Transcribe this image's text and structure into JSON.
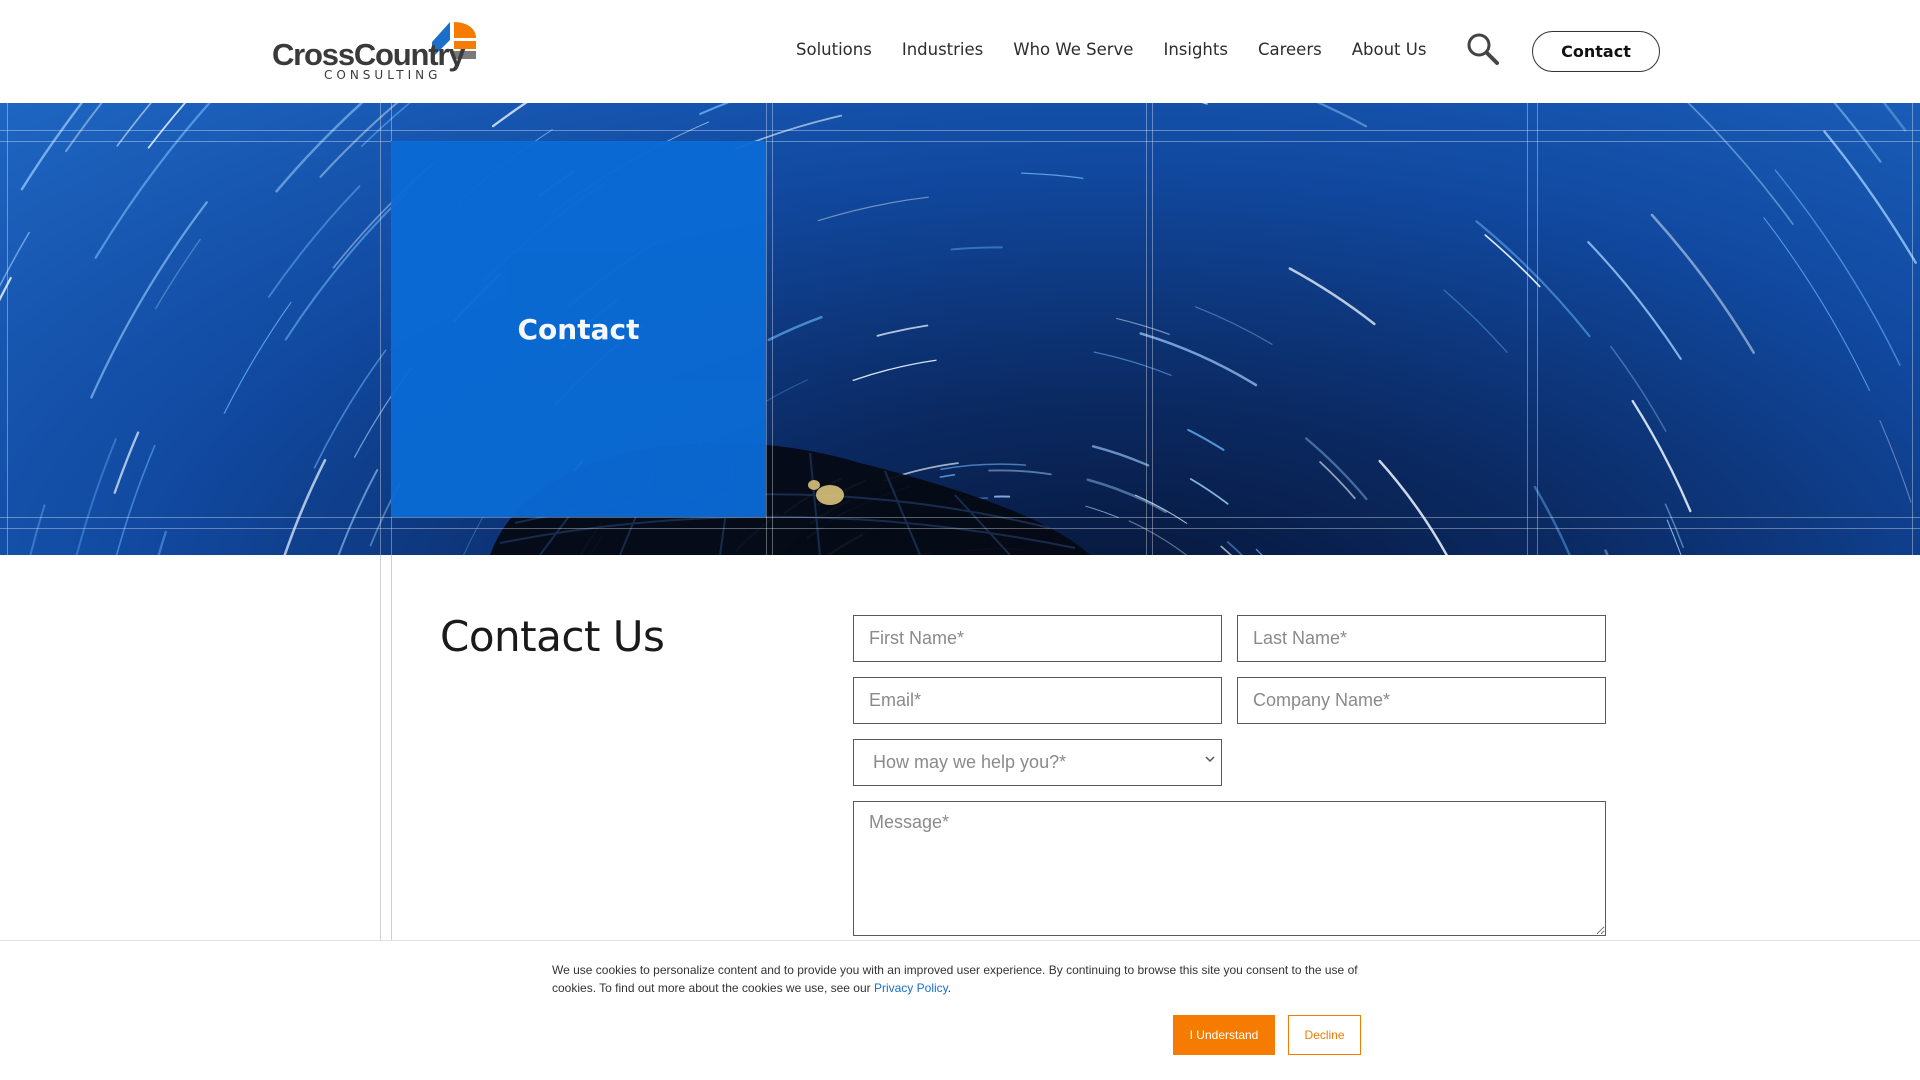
{
  "brand": {
    "name": "CrossCountry",
    "tagline": "CONSULTING",
    "colors": {
      "blue": "#1a6fc9",
      "orange": "#f57c00",
      "gray": "#555555"
    }
  },
  "nav": {
    "items": [
      {
        "label": "Solutions"
      },
      {
        "label": "Industries"
      },
      {
        "label": "Who We Serve"
      },
      {
        "label": "Insights"
      },
      {
        "label": "Careers"
      },
      {
        "label": "About Us"
      }
    ],
    "search_icon": "search-icon",
    "contact_label": "Contact"
  },
  "hero": {
    "title": "Contact",
    "accent": "#0a6ad4"
  },
  "main": {
    "heading": "Contact Us",
    "form": {
      "first_name_placeholder": "First Name*",
      "last_name_placeholder": "Last Name*",
      "email_placeholder": "Email*",
      "company_placeholder": "Company Name*",
      "help_select": "How may we help you?*",
      "message_placeholder": "Message*"
    }
  },
  "cookie": {
    "text": "We use cookies to personalize content and to provide you with an improved user experience. By continuing to browse this site you consent to the use of cookies. To find out more about the cookies we use, see our ",
    "link_label": "Privacy Policy",
    "trailing": ".",
    "accept_label": "I Understand",
    "decline_label": "Decline"
  }
}
